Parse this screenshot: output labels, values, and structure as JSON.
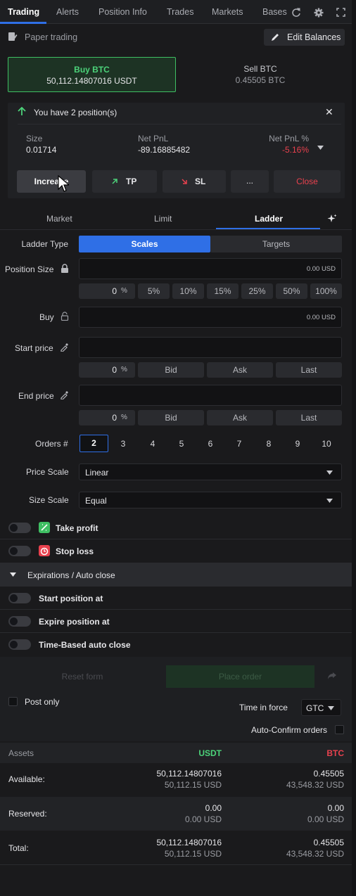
{
  "tabs": [
    {
      "label": "Trading"
    },
    {
      "label": "Alerts"
    },
    {
      "label": "Position Info"
    },
    {
      "label": "Trades"
    },
    {
      "label": "Markets"
    },
    {
      "label": "Bases"
    }
  ],
  "header": {
    "paper_trading": "Paper trading",
    "edit_balances": "Edit Balances"
  },
  "side": {
    "buy": {
      "label": "Buy BTC",
      "value": "50,112.14807016 USDT"
    },
    "sell": {
      "label": "Sell BTC",
      "value": "0.45505 BTC"
    }
  },
  "position": {
    "message": "You have 2 position(s)",
    "size_label": "Size",
    "size_value": "0.01714",
    "pnl_label": "Net PnL",
    "pnl_value": "-89.16885482",
    "pnlpct_label": "Net PnL %",
    "pnlpct_value": "-5.16%",
    "actions": {
      "increase": "Increase",
      "tp": "TP",
      "sl": "SL",
      "more": "...",
      "close": "Close"
    }
  },
  "order_tabs": [
    {
      "label": "Market"
    },
    {
      "label": "Limit"
    },
    {
      "label": "Ladder"
    }
  ],
  "form": {
    "ladder_type_label": "Ladder Type",
    "ladder_types": [
      {
        "label": "Scales"
      },
      {
        "label": "Targets"
      }
    ],
    "position_size_label": "Position Size",
    "position_size_value": "0.00 USD",
    "percent_value": "0",
    "percent_sign": "%",
    "percent_options": [
      {
        "label": "5%"
      },
      {
        "label": "10%"
      },
      {
        "label": "15%"
      },
      {
        "label": "25%"
      },
      {
        "label": "50%"
      },
      {
        "label": "100%"
      }
    ],
    "buy_label": "Buy",
    "buy_value": "0.00 USD",
    "start_price_label": "Start price",
    "end_price_label": "End price",
    "offset_value": "0",
    "price_refs": [
      {
        "label": "Bid"
      },
      {
        "label": "Ask"
      },
      {
        "label": "Last"
      }
    ],
    "orders_label": "Orders #",
    "orders_options": [
      "2",
      "3",
      "4",
      "5",
      "6",
      "7",
      "8",
      "9",
      "10"
    ],
    "price_scale_label": "Price Scale",
    "price_scale_value": "Linear",
    "size_scale_label": "Size Scale",
    "size_scale_value": "Equal",
    "take_profit": "Take profit",
    "stop_loss": "Stop loss",
    "expirations": "Expirations / Auto close",
    "start_position_at": "Start position at",
    "expire_position_at": "Expire position at",
    "time_based": "Time-Based auto close",
    "reset": "Reset form",
    "place": "Place order",
    "post_only": "Post only",
    "tif_label": "Time in force",
    "tif_value": "GTC",
    "auto_confirm": "Auto-Confirm orders"
  },
  "assets": {
    "header": "Assets",
    "usdt": "USDT",
    "btc": "BTC",
    "rows": [
      {
        "label": "Available:",
        "usdt1": "50,112.14807016",
        "usdt2": "50,112.15 USD",
        "btc1": "0.45505",
        "btc2": "43,548.32 USD"
      },
      {
        "label": "Reserved:",
        "usdt1": "0.00",
        "usdt2": "0.00 USD",
        "btc1": "0.00",
        "btc2": "0.00 USD"
      },
      {
        "label": "Total:",
        "usdt1": "50,112.14807016",
        "usdt2": "50,112.15 USD",
        "btc1": "0.45505",
        "btc2": "43,548.32 USD"
      }
    ]
  },
  "colors": {
    "accent": "#2f6fe6",
    "green": "#4cd37a",
    "red": "#e8414e"
  }
}
